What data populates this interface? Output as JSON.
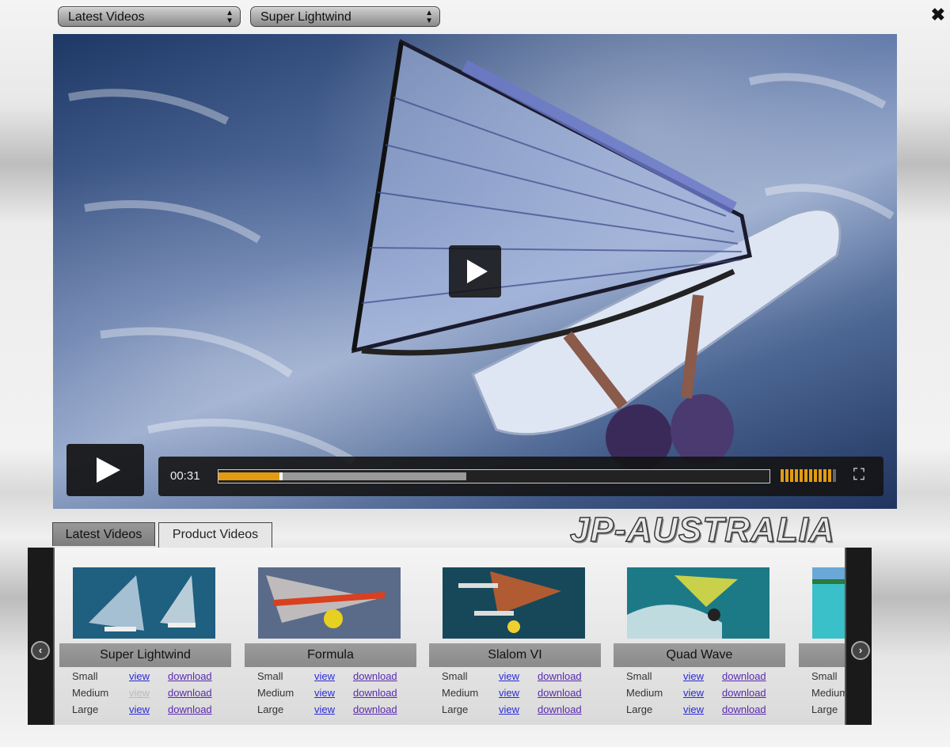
{
  "selectors": {
    "category": "Latest Videos",
    "product": "Super Lightwind"
  },
  "player": {
    "time": "00:31",
    "progress": 0.11,
    "buffered": 0.45,
    "volume_level": 0.9,
    "icons": [
      "play-icon",
      "fullscreen-icon"
    ]
  },
  "tabs": [
    {
      "label": "Latest Videos"
    },
    {
      "label": "Product Videos",
      "active": true
    }
  ],
  "brand": {
    "logo_text": "JP-AUSTRALIA"
  },
  "videos": [
    {
      "title": "Super Lightwind",
      "rows": [
        {
          "size": "Small",
          "view": "view",
          "download": "download"
        },
        {
          "size": "Medium",
          "view": "view",
          "download": "download"
        },
        {
          "size": "Large",
          "view": "view",
          "download": "download"
        }
      ]
    },
    {
      "title": "Formula",
      "rows": [
        {
          "size": "Small",
          "view": "view",
          "download": "download"
        },
        {
          "size": "Medium",
          "view": "view",
          "download": "download"
        },
        {
          "size": "Large",
          "view": "view",
          "download": "download"
        }
      ]
    },
    {
      "title": "Slalom VI",
      "rows": [
        {
          "size": "Small",
          "view": "view",
          "download": "download"
        },
        {
          "size": "Medium",
          "view": "view",
          "download": "download"
        },
        {
          "size": "Large",
          "view": "view",
          "download": "download"
        }
      ]
    },
    {
      "title": "Quad Wave",
      "rows": [
        {
          "size": "Small",
          "view": "view",
          "download": "download"
        },
        {
          "size": "Medium",
          "view": "view",
          "download": "download"
        },
        {
          "size": "Large",
          "view": "view",
          "download": "download"
        }
      ]
    },
    {
      "title": "",
      "rows": [
        {
          "size": "Small",
          "view": "",
          "download": ""
        },
        {
          "size": "Medium",
          "view": "",
          "download": ""
        },
        {
          "size": "Large",
          "view": "",
          "download": ""
        }
      ]
    }
  ],
  "colors": {
    "progress": "#e39b12",
    "link": "#2a2ad8",
    "visited_link": "#5a2ab0"
  }
}
